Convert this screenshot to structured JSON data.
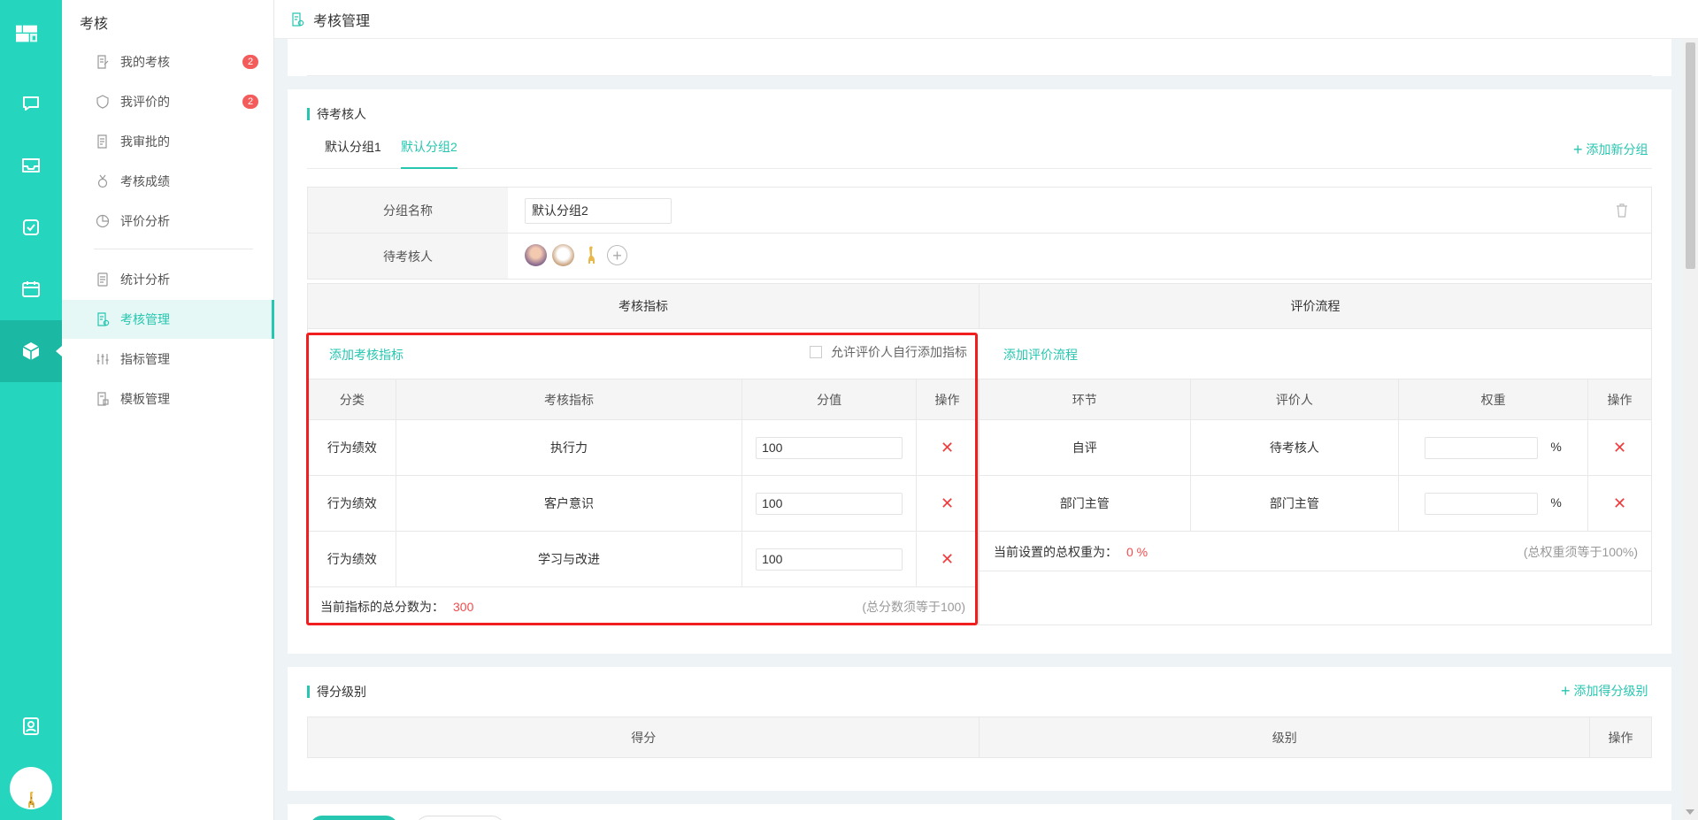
{
  "app": {
    "section_title": "考核",
    "page_title": "考核管理"
  },
  "rail": {
    "icons": [
      "dashboard-icon",
      "chat-icon",
      "inbox-icon",
      "check-square-icon",
      "calendar-icon",
      "cube-icon",
      "contacts-icon"
    ],
    "active": "cube-icon"
  },
  "nav": {
    "items": [
      {
        "label": "我的考核",
        "badge": "2",
        "icon": "edit-doc-icon"
      },
      {
        "label": "我评价的",
        "badge": "2",
        "icon": "shield-icon"
      },
      {
        "label": "我审批的",
        "badge": "",
        "icon": "approve-doc-icon"
      },
      {
        "label": "考核成绩",
        "badge": "",
        "icon": "medal-icon"
      },
      {
        "label": "评价分析",
        "badge": "",
        "icon": "pie-icon"
      },
      {
        "label": "统计分析",
        "badge": "",
        "icon": "stats-doc-icon"
      },
      {
        "label": "考核管理",
        "badge": "",
        "icon": "manage-doc-icon",
        "active": true
      },
      {
        "label": "指标管理",
        "badge": "",
        "icon": "sliders-icon"
      },
      {
        "label": "模板管理",
        "badge": "",
        "icon": "template-icon"
      }
    ]
  },
  "pending": {
    "title": "待考核人",
    "tabs": [
      "默认分组1",
      "默认分组2"
    ],
    "active_tab": 1,
    "add_group": "添加新分组",
    "group_name_label": "分组名称",
    "group_name_value": "默认分组2",
    "assessee_label": "待考核人",
    "indicator_header": "考核指标",
    "process_header": "评价流程"
  },
  "indicators": {
    "add_label": "添加考核指标",
    "allow_label": "允许评价人自行添加指标",
    "columns": [
      "分类",
      "考核指标",
      "分值",
      "操作"
    ],
    "rows": [
      {
        "category": "行为绩效",
        "name": "执行力",
        "score": "100"
      },
      {
        "category": "行为绩效",
        "name": "客户意识",
        "score": "100"
      },
      {
        "category": "行为绩效",
        "name": "学习与改进",
        "score": "100"
      }
    ],
    "total_label": "当前指标的总分数为：",
    "total_value": "300",
    "total_hint": "(总分数须等于100)"
  },
  "process": {
    "add_label": "添加评价流程",
    "columns": [
      "环节",
      "评价人",
      "权重",
      "操作"
    ],
    "rows": [
      {
        "stage": "自评",
        "evaluator": "待考核人",
        "unit": "%"
      },
      {
        "stage": "部门主管",
        "evaluator": "部门主管",
        "unit": "%"
      }
    ],
    "total_label": "当前设置的总权重为：",
    "total_value": "0 %",
    "total_hint": "(总权重须等于100%)"
  },
  "grade": {
    "title": "得分级别",
    "add_label": "添加得分级别",
    "columns": [
      "得分",
      "级别",
      "操作"
    ]
  },
  "colors": {
    "accent": "#26c6b0",
    "rail": "#26d5bd",
    "danger": "#f03c3c",
    "highlight_frame": "#f01e1e"
  }
}
